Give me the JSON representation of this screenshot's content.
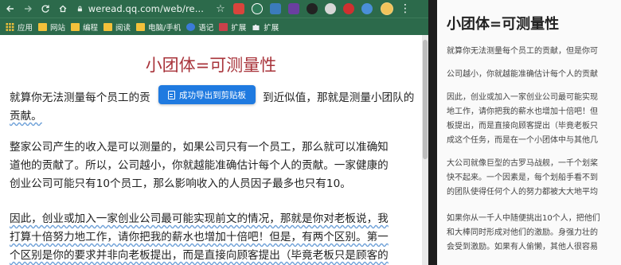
{
  "browser": {
    "url": "weread.qq.com/web/re...",
    "bookmarks": [
      {
        "label": "应用",
        "icon": "apps-grid-icon"
      },
      {
        "label": "网站",
        "icon": "folder-icon"
      },
      {
        "label": "编程",
        "icon": "folder-icon"
      },
      {
        "label": "阅读",
        "icon": "folder-icon"
      },
      {
        "label": "电脑/手机",
        "icon": "folder-icon"
      },
      {
        "label": "语记",
        "icon": "note-app-icon"
      },
      {
        "label": "扩展",
        "icon": "extension-app-icon"
      },
      {
        "label": "扩展",
        "icon": "puzzle-icon"
      }
    ],
    "theme_color": "#2c6a4b"
  },
  "article": {
    "title": "小团体=可测量性",
    "title_color": "#a8333a",
    "para1": [
      "就算你无法测量每个员工的贡",
      "到近似值，那就是测量小团队的",
      "贡献。"
    ],
    "para2": [
      "整家公司产生的收入是可以测量的，如果公司只有一个员工，那么就可以准确知",
      "道他的贡献了。所以，公司越小，你就越能准确估计每个人的贡献。一家健康的",
      "创业公司可能只有10个员工，那么影响收入的人员因子最多也只有10。"
    ],
    "para3": [
      "因此，创业或加入一家创业公司最可能实现前文的情况，那就是你对老板说，我",
      "打算十倍努力地工作，请你把我的薪水也增加十倍吧！但是，有两个区别。第一",
      "个区别是你的要求并非向老板提出，而是直接向顾客提出（毕竟老板只是顾客的"
    ]
  },
  "export_button": {
    "label": "成功导出到剪贴板",
    "color": "#1f7ae0"
  },
  "right_panel": {
    "title": "小团体=可测量性",
    "lines": [
      "就算你无法测量每个员工的贡献，但是你可",
      "公司越小，你就越能准确估计每个人的贡献",
      "因此，创业或加入一家创业公司最可能实现",
      "地工作，请你把我的薪水也增加十倍吧！但",
      "板提出，而是直接向顾客提出（毕竟老板只",
      "成这个任务，而是在一个小团体中与其他几",
      "大公司就像巨型的古罗马战舰，一千个划桨",
      "快不起来。一个因素是，每个划船手看不到",
      "的团队使得任何个人的努力都被大大地平均",
      "如果你从一千人中随便挑出10个人，把他们",
      "和大棒同时形成对他们的激励。身强力壮的",
      "会受到激励。如果有人偷懒，其他人很容易"
    ]
  }
}
